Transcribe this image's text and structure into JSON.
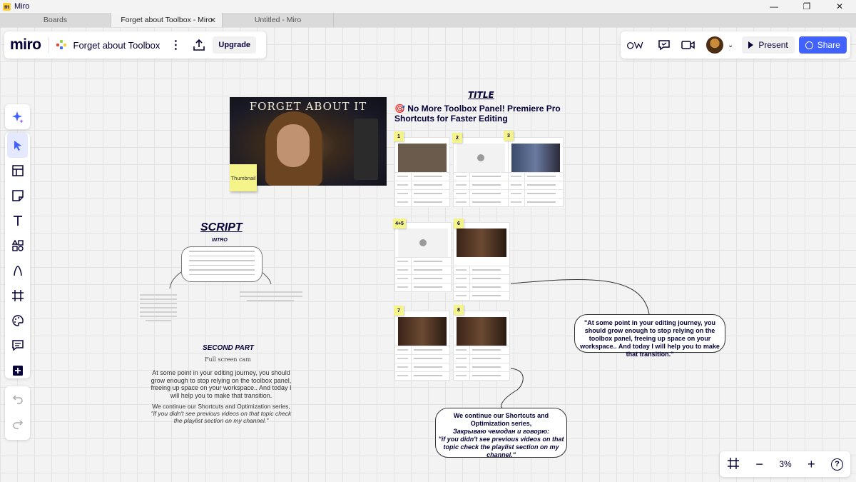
{
  "app": {
    "title": "Miro",
    "window_controls": [
      "—",
      "❐",
      "✕"
    ]
  },
  "tabs": [
    {
      "label": "Boards"
    },
    {
      "label": "Forget about Toolbox - Miro"
    },
    {
      "label": "Untitled - Miro"
    }
  ],
  "tab_close": "✕",
  "header": {
    "logo": "miro",
    "board_name": "Forget about Toolbox",
    "more": "⋮",
    "upgrade_label": "Upgrade"
  },
  "top_right": {
    "present_label": "Present",
    "share_label": "Share",
    "chevron": "⌄",
    "colors": {
      "share_bg": "#4262ff"
    }
  },
  "toolbar": {
    "ai": "ai-sparkle-icon",
    "tools": [
      "select",
      "templates",
      "sticky-note",
      "text",
      "shapes",
      "pen",
      "frame",
      "sticker",
      "comment",
      "more"
    ],
    "undo": "undo-icon",
    "redo": "redo-icon"
  },
  "zoom": {
    "minus": "−",
    "plus": "+",
    "help": "?",
    "level": "3%"
  },
  "board": {
    "thumbnail": {
      "title": "FORGET ABOUT IT",
      "sticky": "Thumbnail"
    },
    "title_section": {
      "heading": "TITLE",
      "text": "🎯 No More Toolbox Panel! Premiere Pro Shortcuts for Faster Editing"
    },
    "frames": [
      {
        "num": "1"
      },
      {
        "num": "2"
      },
      {
        "num": "3"
      },
      {
        "num": "4+5"
      },
      {
        "num": "6"
      },
      {
        "num": "7"
      },
      {
        "num": "8"
      }
    ],
    "script": {
      "heading": "SCRIPT",
      "intro": "INTRO",
      "second_part": "SECOND PART",
      "full_screen": "Full screen cam",
      "para1": "At some point in your editing journey, you should grow enough to stop relying on the toolbox panel, freeing up space on your workspace.. And today I will help you to make that transition.",
      "para2_a": "We continue our Shortcuts and Optimization series,",
      "para2_b": "\"if you didn't see previous videos on that topic check the playlist section on my channel.\""
    },
    "bubble1": "\"At some point in your editing journey, you should grow enough to stop relying on the toolbox panel, freeing up space on your workspace.. And today I will help you to make that transition.\"",
    "bubble2": {
      "line1": "We continue our Shortcuts and Optimization series,",
      "line2": "Закрываю чемодан и говорю:",
      "line3": "\"if you didn't see previous videos on that topic check the playlist section on my channel.\""
    }
  }
}
